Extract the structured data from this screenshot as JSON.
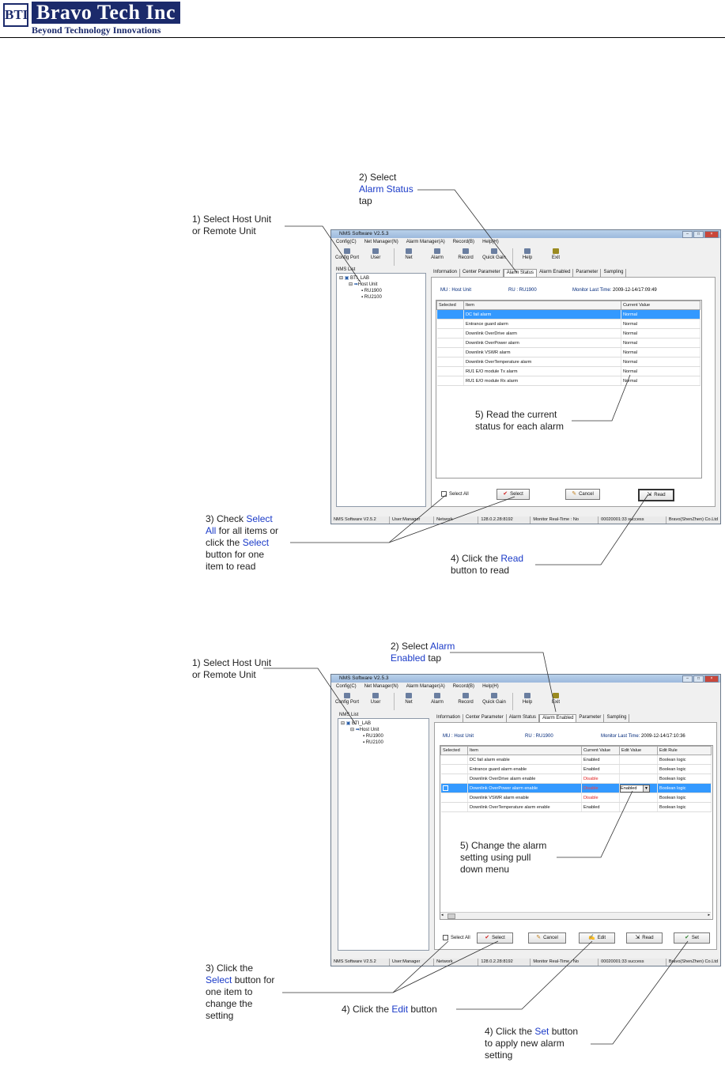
{
  "header": {
    "logo_mark": "BTI",
    "company_name": "Bravo Tech Inc",
    "tagline": "Beyond Technology Innovations"
  },
  "fig1": {
    "annotations": {
      "a1_line1": "1) Select Host Unit",
      "a1_line2": "or Remote Unit",
      "a2_line1": "2) Select",
      "a2_line2": "Alarm Status",
      "a2_line3": "tap",
      "a3_pre": "3) Check ",
      "a3_hl1": "Select",
      "a3_hl2": "All",
      "a3_mid": " for all items or",
      "a3_pre3": "click the ",
      "a3_hl3": "Select",
      "a3_line4": "button for one",
      "a3_line5": "item to read",
      "a4_pre": "4) Click the ",
      "a4_hl": "Read",
      "a4_line2": "button to read",
      "a5_line1": "5) Read the current",
      "a5_line2": "status for each alarm"
    },
    "window": {
      "title": "NMS Software V2.5.3",
      "menu": [
        "Config(C)",
        "Net Manager(N)",
        "Alarm Manager(A)",
        "Record(B)",
        "Help(H)"
      ],
      "toolbar": [
        "Config Port",
        "User",
        "Net",
        "Alarm",
        "Record",
        "Quick Gain",
        "Help",
        "Exit"
      ],
      "tree": {
        "label": "NMS List",
        "root": "BTI_LAB",
        "host": "Host Unit",
        "children": [
          "RU1900",
          "RU2100"
        ]
      },
      "tabs": [
        "Information",
        "Center Parameter",
        "Alarm Status",
        "Alarm Enabled",
        "Parameter",
        "Sampling"
      ],
      "info": {
        "mu": "MU : Host Unit",
        "ru": "RU : RU1900",
        "monitor": "Monitor Last Time:",
        "monitor_time": "2009-12-14/17:09:49"
      },
      "columns": [
        "Selected",
        "Item",
        "Current Value"
      ],
      "rows": [
        {
          "item": "DC fail alarm",
          "value": "Normal"
        },
        {
          "item": "Entrance guard alarm",
          "value": "Normal"
        },
        {
          "item": "Downlink OverDrive alarm",
          "value": "Normal"
        },
        {
          "item": "Downlink OverPower alarm",
          "value": "Normal"
        },
        {
          "item": "Downlink VSWR alarm",
          "value": "Normal"
        },
        {
          "item": "Downlink OverTemperature alarm",
          "value": "Normal"
        },
        {
          "item": "RU1 E/O module Tx alarm",
          "value": "Normal"
        },
        {
          "item": "RU1 E/O module Rx alarm",
          "value": "Normal"
        }
      ],
      "buttons": {
        "select_all": "Select All",
        "select": "Select",
        "cancel": "Cancel",
        "read": "Read"
      },
      "status": [
        "NMS Software V2.5.2",
        "User:Manager",
        "Network",
        "128.0.2.28:8192",
        "Monitor Real-Time : No",
        "00020001:33 success",
        "Bravo(ShenZhen) Co.Ltd"
      ]
    }
  },
  "fig2": {
    "annotations": {
      "a1_line1": "1) Select Host Unit",
      "a1_line2": "or Remote Unit",
      "a2_pre": "2) Select ",
      "a2_hl1": "Alarm",
      "a2_hl2": "Enabled",
      "a2_post": " tap",
      "a3_line1": "3) Click the",
      "a3_hl": "Select",
      "a3_post2": " button for",
      "a3_line3": "one item to",
      "a3_line4": "change the",
      "a3_line5": "setting",
      "a4_pre": "4) Click the ",
      "a4_hl": "Edit",
      "a4_post": " button",
      "a5_line1": "5) Change the alarm",
      "a5_line2": "setting using pull",
      "a5_line3": "down menu",
      "a6_pre": "4) Click the ",
      "a6_hl": "Set",
      "a6_post": " button",
      "a6_line2": "to apply new alarm",
      "a6_line3": "setting"
    },
    "window": {
      "title": "NMS Software V2.5.3",
      "menu": [
        "Config(C)",
        "Net Manager(N)",
        "Alarm Manager(A)",
        "Record(B)",
        "Help(H)"
      ],
      "toolbar": [
        "Config Port",
        "User",
        "Net",
        "Alarm",
        "Record",
        "Quick Gain",
        "Help",
        "Exit"
      ],
      "tree": {
        "label": "NMS List",
        "root": "BTI_LAB",
        "host": "Host Unit",
        "children": [
          "RU1900",
          "RU2100"
        ]
      },
      "tabs": [
        "Information",
        "Center Parameter",
        "Alarm Status",
        "Alarm Enabled",
        "Parameter",
        "Sampling"
      ],
      "info": {
        "mu": "MU : Host Unit",
        "ru": "RU : RU1900",
        "monitor": "Monitor Last Time:",
        "monitor_time": "2009-12-14/17:10:36"
      },
      "columns": [
        "Selected",
        "Item",
        "Current Value",
        "Edit Value",
        "Edit Rule"
      ],
      "rows": [
        {
          "item": "DC fail alarm enable",
          "value": "Enabled",
          "edit": "",
          "rule": "Boolean logic",
          "red": false
        },
        {
          "item": "Entrance guard alarm enable",
          "value": "Enabled",
          "edit": "",
          "rule": "Boolean logic",
          "red": false
        },
        {
          "item": "Downlink OverDrive alarm enable",
          "value": "Disable",
          "edit": "",
          "rule": "Boolean logic",
          "red": true
        },
        {
          "item": "Downlink OverPower alarm enable",
          "value": "Disable",
          "edit": "Enabled",
          "rule": "Boolean logic",
          "red": true
        },
        {
          "item": "Downlink VSWR alarm enable",
          "value": "Disable",
          "edit": "",
          "rule": "Boolean logic",
          "red": true
        },
        {
          "item": "Downlink OverTemperature alarm enable",
          "value": "Enabled",
          "edit": "",
          "rule": "Boolean logic",
          "red": false
        }
      ],
      "buttons": {
        "select_all": "Select All",
        "select": "Select",
        "cancel": "Cancel",
        "edit": "Edit",
        "read": "Read",
        "set": "Set"
      },
      "status": [
        "NMS Software V2.5.2",
        "User:Manager",
        "Network",
        "128.0.2.28:8192",
        "Monitor Real-Time : No",
        "00020001:33 success",
        "Bravo(ShenZhen) Co.Ltd"
      ]
    }
  }
}
